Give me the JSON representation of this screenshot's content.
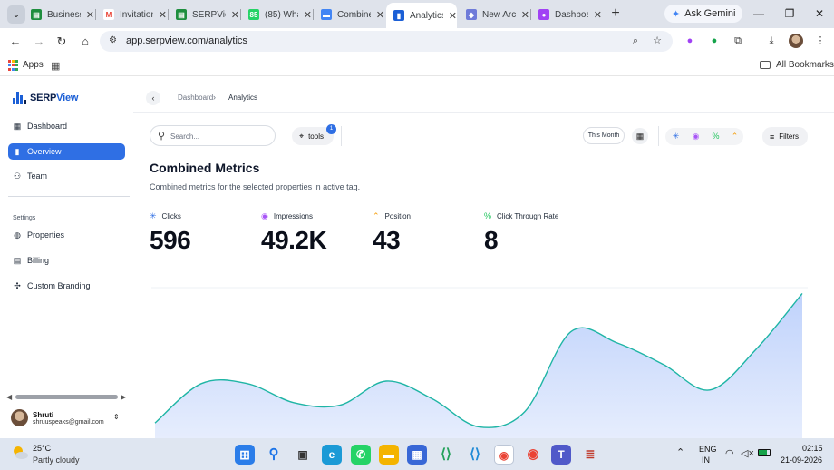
{
  "browser": {
    "tabs": [
      {
        "title": "Business",
        "favicon_color": "#1e8e3e",
        "favicon_glyph": "▤"
      },
      {
        "title": "Invitation",
        "favicon_color": "#ffffff",
        "favicon_glyph": "M"
      },
      {
        "title": "SERPView",
        "favicon_color": "#1e8e3e",
        "favicon_glyph": "▤"
      },
      {
        "title": "(85) WhatsApp",
        "favicon_color": "#25d366",
        "favicon_glyph": "85"
      },
      {
        "title": "Combined",
        "favicon_color": "#4285f4",
        "favicon_glyph": "▬"
      },
      {
        "title": "Analytics",
        "favicon_color": "#1b5fd6",
        "favicon_glyph": "▮",
        "active": true
      },
      {
        "title": "New Arc",
        "favicon_color": "#6f7bd9",
        "favicon_glyph": "◆"
      },
      {
        "title": "Dashboard",
        "favicon_color": "#a142f4",
        "favicon_glyph": "●"
      }
    ],
    "ask_gemini": "Ask Gemini",
    "url": "app.serpview.com/analytics",
    "bookmarks": {
      "apps": "Apps",
      "all_bookmarks": "All Bookmarks"
    }
  },
  "sidebar": {
    "logo_prefix": "SERP",
    "logo_suffix": "View",
    "items": [
      {
        "label": "Dashboard",
        "icon": "grid-icon"
      },
      {
        "label": "Overview",
        "icon": "bar-chart-icon",
        "active": true
      },
      {
        "label": "Team",
        "icon": "users-icon"
      }
    ],
    "settings_label": "Settings",
    "settings_items": [
      {
        "label": "Properties",
        "icon": "globe-icon"
      },
      {
        "label": "Billing",
        "icon": "receipt-icon"
      },
      {
        "label": "Custom Branding",
        "icon": "sparkle-icon"
      }
    ],
    "user": {
      "name": "Shruti",
      "email": "shruuspeaks@gmail.com"
    }
  },
  "breadcrumb": {
    "parent": "Dashboard",
    "current": "Analytics"
  },
  "toolbar": {
    "search_placeholder": "Search...",
    "tools_label": "tools",
    "tools_count": "1",
    "date_range": "This Month",
    "filters_label": "Filters"
  },
  "header": {
    "title": "Combined Metrics",
    "subtitle": "Combined metrics for the selected properties in active tag."
  },
  "metrics": [
    {
      "label": "Clicks",
      "value": "596",
      "icon": "cursor-click-icon",
      "color": "#2f6fe4"
    },
    {
      "label": "Impressions",
      "value": "49.2K",
      "icon": "eye-icon",
      "color": "#a855f7"
    },
    {
      "label": "Position",
      "value": "43",
      "icon": "chevrons-up-icon",
      "color": "#f59e0b"
    },
    {
      "label": "Click Through Rate",
      "value": "8",
      "icon": "percent-icon",
      "color": "#22c55e"
    }
  ],
  "chart_data": {
    "type": "area",
    "series": [
      {
        "values": [
          12,
          43,
          43,
          28,
          26,
          45,
          31,
          9,
          21,
          84,
          75,
          58,
          38,
          70,
          114
        ],
        "color": "#1fb5a5"
      }
    ],
    "ylim": [
      0,
      120
    ],
    "grid": false
  },
  "taskbar": {
    "temperature": "25°C",
    "weather": "Partly cloudy",
    "language_top": "ENG",
    "language_bottom": "IN",
    "time": "02:15",
    "date": "21-09-2026"
  }
}
